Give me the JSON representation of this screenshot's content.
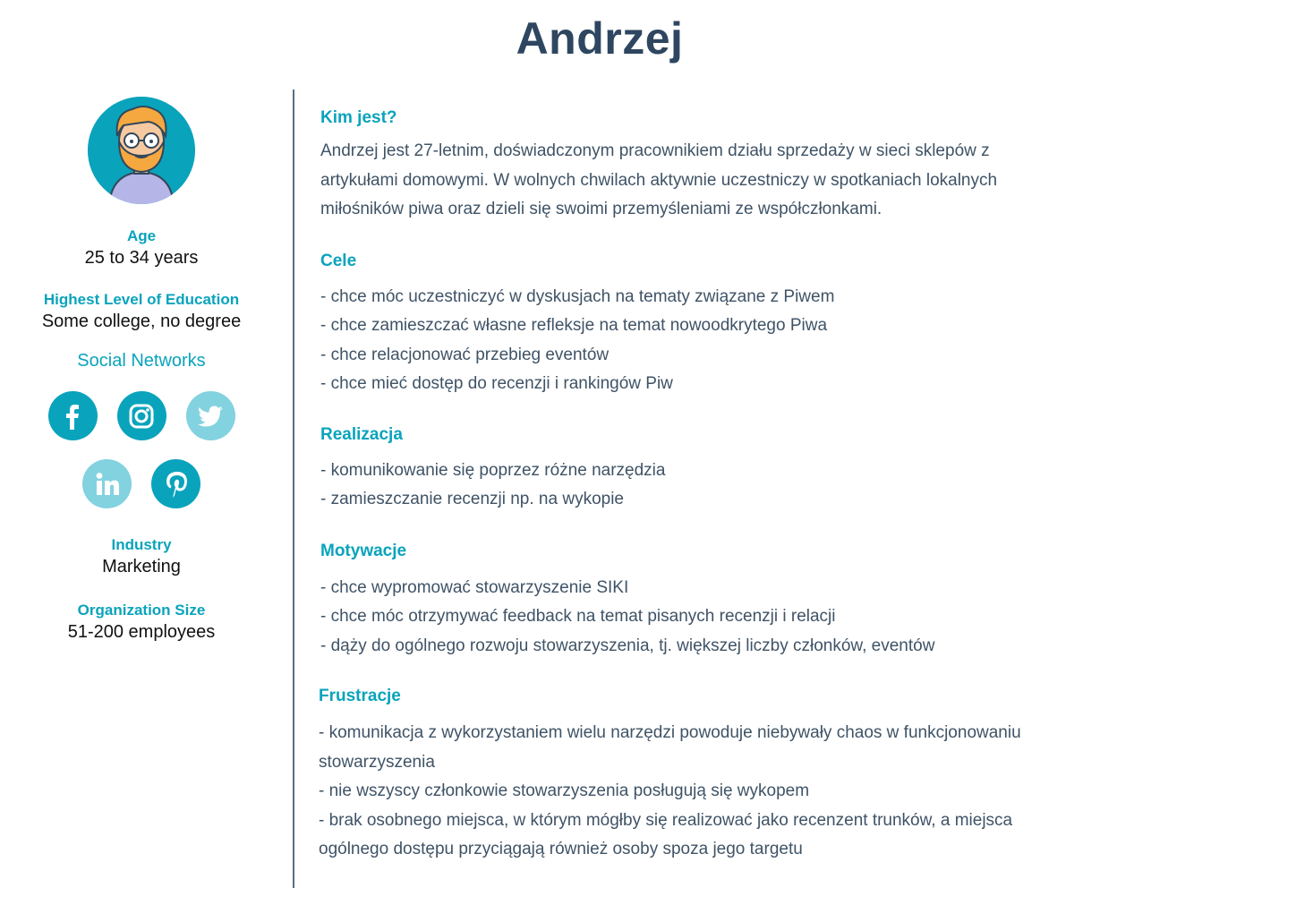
{
  "persona": {
    "name": "Andrzej"
  },
  "sidebar": {
    "age_label": "Age",
    "age_value": "25 to 34 years",
    "education_label": "Highest Level of Education",
    "education_value": "Some college, no degree",
    "social_title": "Social Networks",
    "social_icons": [
      "facebook-icon",
      "instagram-icon",
      "twitter-icon",
      "linkedin-icon",
      "pinterest-icon"
    ],
    "industry_label": "Industry",
    "industry_value": "Marketing",
    "org_label": "Organization Size",
    "org_value": "51-200 employees"
  },
  "colors": {
    "accent": "#0aa3bc",
    "accent_light": "#82d2e0",
    "title": "#2e4660"
  },
  "sections": {
    "who": {
      "title": "Kim jest?",
      "lines": [
        "Andrzej jest 27-letnim, doświadczonym pracownikiem działu sprzedaży w sieci sklepów z",
        "artykułami domowymi. W wolnych chwilach aktywnie uczestniczy w spotkaniach lokalnych",
        "miłośników piwa oraz dzieli się swoimi przemyśleniami ze współczłonkami."
      ]
    },
    "goals": {
      "title": "Cele",
      "items": [
        "- chce móc uczestniczyć w dyskusjach na tematy związane z Piwem",
        "- chce zamieszczać własne refleksje na temat nowoodkrytego Piwa",
        "- chce relacjonować przebieg eventów",
        "- chce mieć dostęp do recenzji i rankingów Piw"
      ]
    },
    "realization": {
      "title": "Realizacja",
      "items": [
        "- komunikowanie się poprzez różne narzędzia",
        "- zamieszczanie recenzji np. na wykopie"
      ]
    },
    "motivation": {
      "title": "Motywacje",
      "items": [
        "- chce wypromować stowarzyszenie SIKI",
        "- chce móc otrzymywać feedback na temat pisanych recenzji i relacji",
        "- dąży do ogólnego rozwoju stowarzyszenia, tj. większej liczby członków, eventów"
      ]
    },
    "frustrations": {
      "title": "Frustracje",
      "items": [
        "- komunikacja z wykorzystaniem wielu narzędzi powoduje niebywały chaos w funkcjonowaniu",
        "stowarzyszenia",
        "- nie wszyscy członkowie stowarzyszenia posługują się wykopem",
        "- brak osobnego miejsca, w którym mógłby się realizować jako recenzent trunków, a miejsca",
        "ogólnego dostępu przyciągają również osoby spoza jego targetu"
      ]
    }
  }
}
